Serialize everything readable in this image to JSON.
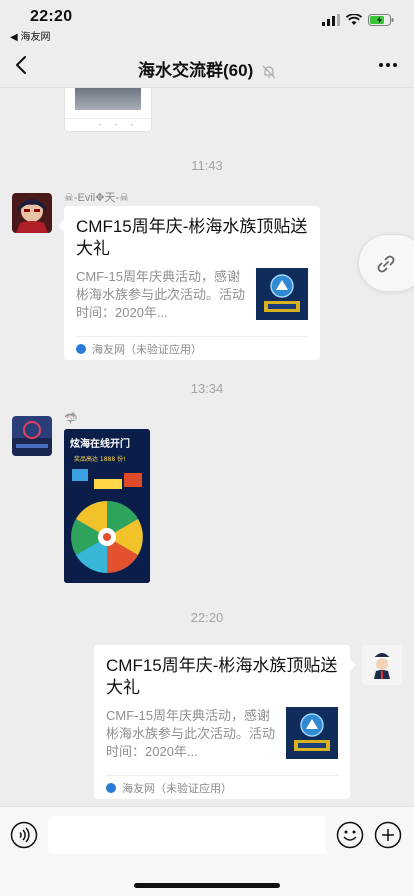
{
  "status_bar": {
    "time": "22:20",
    "back_app": "◀ 海友网"
  },
  "nav": {
    "title": "海水交流群(60)"
  },
  "messages": [
    {
      "timestamp": "11:43",
      "sender": "☠-Evil✥天-☠",
      "card": {
        "title": "CMF15周年庆-彬海水族顶贴送大礼",
        "desc": "CMF-15周年庆典活动，感谢彬海水族参与此次活动。活动时间：2020年...",
        "source": "海友网（未验证应用）"
      }
    },
    {
      "timestamp": "13:34",
      "sender": "🦈"
    },
    {
      "timestamp": "22:20",
      "card": {
        "title": "CMF15周年庆-彬海水族顶贴送大礼",
        "desc": "CMF-15周年庆典活动，感谢彬海水族参与此次活动。活动时间：2020年...",
        "source": "海友网（未验证应用）"
      }
    }
  ],
  "poster_text": {
    "headline": "炫海在线开门",
    "sub": "奖品高达 1888 份!"
  },
  "colors": {
    "background": "#ededed",
    "card": "#ffffff",
    "thumb": "#0f2c5a",
    "brand": "#2a7ad8"
  },
  "icons": [
    "back-chevron-icon",
    "mute-bell-icon",
    "more-dots-icon",
    "link-icon",
    "voice-icon",
    "emoji-icon",
    "plus-icon"
  ]
}
